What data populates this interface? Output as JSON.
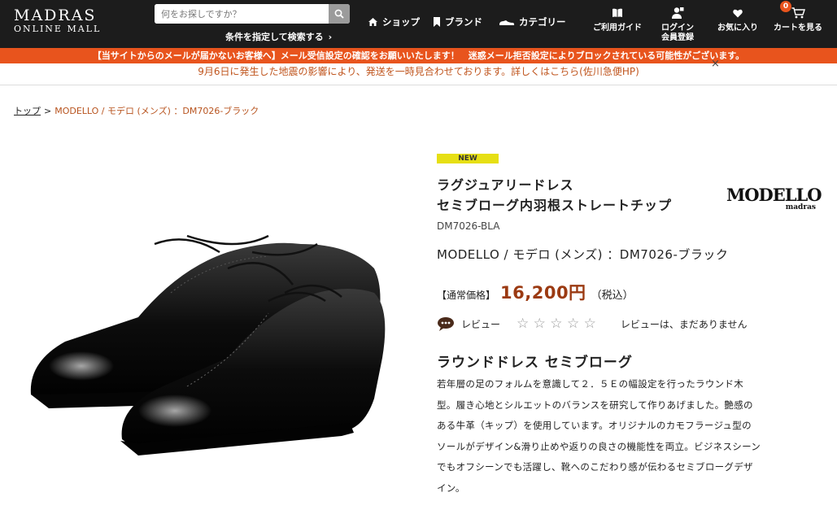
{
  "header": {
    "logo_line1": "MADRAS",
    "logo_line2": "ONLINE MALL",
    "search_placeholder": "何をお探しですか？",
    "advanced_search": "条件を指定して検索する",
    "nav": [
      {
        "label": "ショップ",
        "icon": "home-icon"
      },
      {
        "label": "ブランド",
        "icon": "bookmark-icon"
      },
      {
        "label": "カテゴリー",
        "icon": "shoe-icon"
      }
    ],
    "utility": [
      {
        "label": "ご利用ガイド",
        "icon": "book-icon"
      },
      {
        "label": "ログイン\n会員登録",
        "icon": "user-icon"
      },
      {
        "label": "お気に入り",
        "icon": "heart-icon"
      },
      {
        "label": "カートを見る",
        "icon": "cart-icon"
      }
    ],
    "cart_count": "0"
  },
  "notices": {
    "email_warning": "【当サイトからのメールが届かないお客様へ】メール受信設定の確認をお願いいたします！　迷惑メール拒否設定によりブロックされている可能性がございます。",
    "earthquake": "9月6日に発生した地震の影響により、発送を一時見合わせております。詳しくはこちら(佐川急便HP)",
    "close": "×"
  },
  "breadcrumb": {
    "home": "トップ",
    "separator": ">",
    "current": "MODELLO / モデロ (メンズ) ：DM7026-ブラック"
  },
  "product": {
    "badge": "NEW",
    "name_line1": "ラグジュアリードレス",
    "name_line2": "セミブローグ内羽根ストレートチップ",
    "brand_logo_main": "MODELLO",
    "brand_logo_sub": "madras",
    "code": "DM7026-BLA",
    "subtitle": "MODELLO / モデロ (メンズ) ：DM7026-ブラック",
    "price_label": "【通常価格】",
    "price": "16,200円",
    "price_tax": "（税込）",
    "review_label": "レビュー",
    "rating": 0,
    "stars": "☆ ☆ ☆ ☆ ☆",
    "review_none": "レビューは、まだありません",
    "desc_title": "ラウンドドレス セミブローグ",
    "desc_lines": [
      "若年層の足のフォルムを意識して２．５Ｅの幅設定を行ったラウンド木",
      "型。履き心地とシルエットのバランスを研究して作りあげました。艶感の",
      "ある牛革（キップ）を使用しています。オリジナルのカモフラージュ型の",
      "ソールがデザイン&滑り止めや返りの良さの機能性を両立。ビジネスシーン",
      "でもオフシーンでも活躍し、靴へのこだわり感が伝わるセミブローグデザ",
      "イン。"
    ]
  },
  "colors": {
    "header_bg": "#1c1c1c",
    "notice_orange": "#e8541d",
    "price_red": "#9b3a12",
    "badge_yellow": "#e6df14"
  }
}
